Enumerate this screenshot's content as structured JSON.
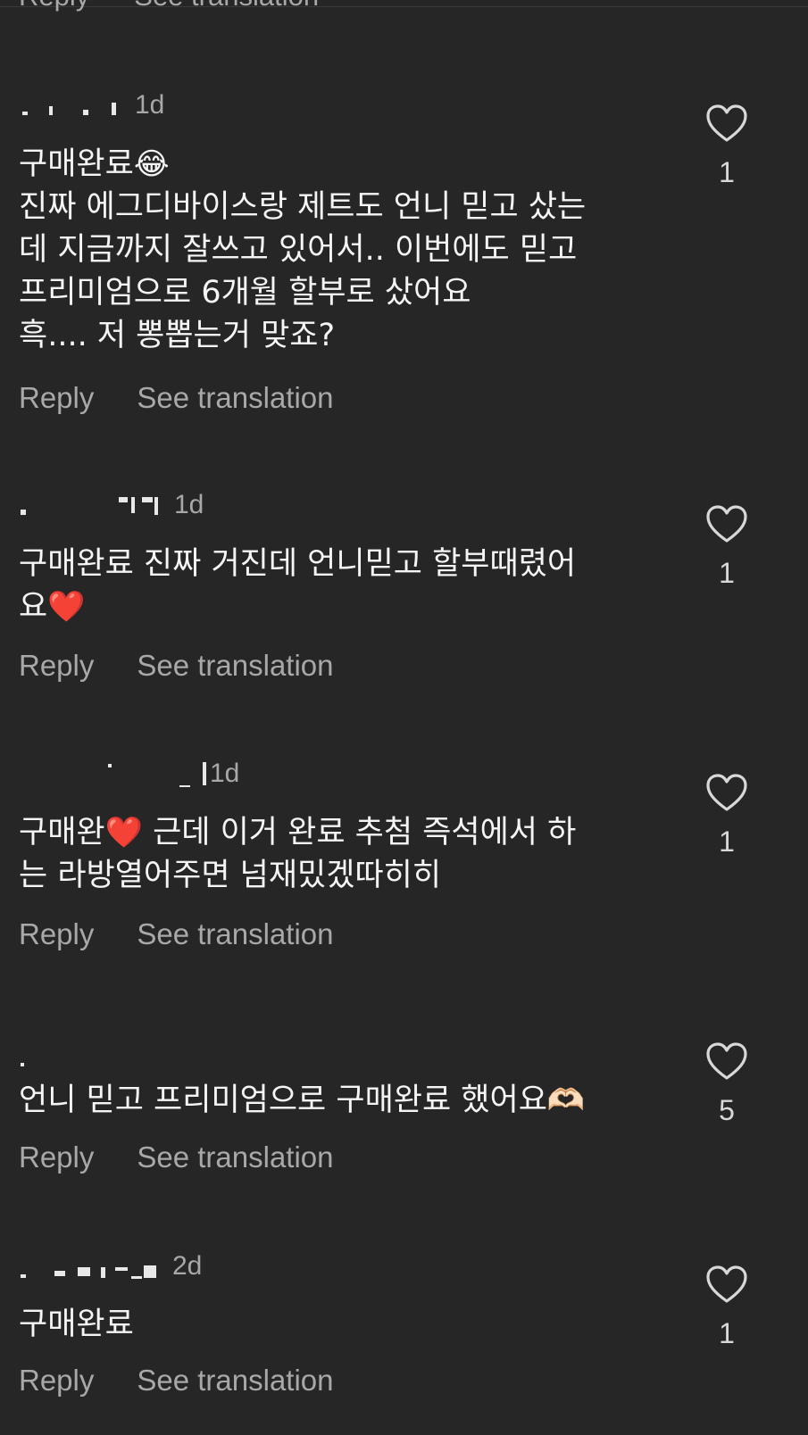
{
  "actions": {
    "reply": "Reply",
    "see_translation": "See translation"
  },
  "icons": {
    "like": "heart-outline-icon",
    "emoji_1": "face-with-tears-of-joy",
    "emoji_2": "red-heart",
    "emoji_3": "red-heart",
    "emoji_4": "heart-hands"
  },
  "colors": {
    "background": "#262626",
    "text": "#f5f5f5",
    "muted": "#a8a8a8",
    "heart": "#e0245e"
  },
  "comments": [
    {
      "time": "1d",
      "line1": "구매완료",
      "line1_emoji": "😂",
      "rest": "진짜 에그디바이스랑 제트도 언니 믿고 샀는\n데 지금까지 잘쓰고 있어서.. 이번에도 믿고\n프리미엄으로 6개월 할부로 샀어요\n흑.... 저 뽕뽑는거 맞죠?",
      "likes": "1"
    },
    {
      "time": "1d",
      "line1": "구매완료 진짜 거진데 언니믿고 할부때렸어\n요",
      "line1_emoji": "❤️",
      "likes": "1"
    },
    {
      "time": "1d",
      "line1": "구매완",
      "line1_emoji": "❤️",
      "rest": " 근데 이거 완료 추첨 즉석에서 하\n는 라방열어주면 넘재밌겠따히히",
      "likes": "1"
    },
    {
      "time": "",
      "line1": "언니 믿고 프리미엄으로 구매완료 했어요",
      "line1_emoji": "🫶🏻",
      "likes": "5"
    },
    {
      "time": "2d",
      "line1": "구매완료",
      "likes": "1"
    }
  ]
}
